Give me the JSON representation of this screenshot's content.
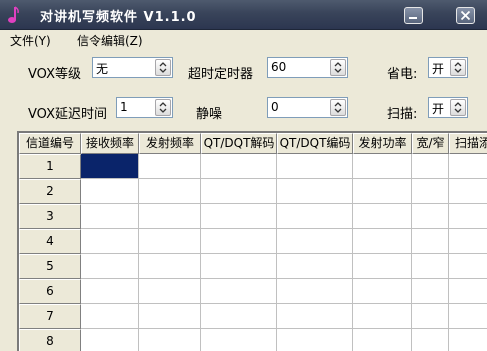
{
  "window": {
    "title": "对讲机写频软件 V1.1.0"
  },
  "menu": {
    "file": "文件(Y)",
    "channel_edit": "信令编辑(Z)"
  },
  "settings": {
    "vox_level": {
      "label": "VOX等级",
      "value": "无"
    },
    "timeout_timer": {
      "label": "超时定时器",
      "value": "60"
    },
    "power_save": {
      "label": "省电:",
      "value": "开"
    },
    "vox_delay": {
      "label": "VOX延迟时间",
      "value": "1"
    },
    "squelch": {
      "label": "静噪",
      "value": "0"
    },
    "scan": {
      "label": "扫描:",
      "value": "开"
    }
  },
  "grid": {
    "columns": [
      "信道编号",
      "接收频率",
      "发射频率",
      "QT/DQT解码",
      "QT/DQT编码",
      "发射功率",
      "宽/窄",
      "扫描添加"
    ],
    "rows": [
      "1",
      "2",
      "3",
      "4",
      "5",
      "6",
      "7",
      "8"
    ],
    "selected": {
      "row": 0,
      "col": 1
    }
  },
  "colors": {
    "title_bar": "#39445A",
    "selection": "#0A246A",
    "face": "#ECE9D8"
  }
}
